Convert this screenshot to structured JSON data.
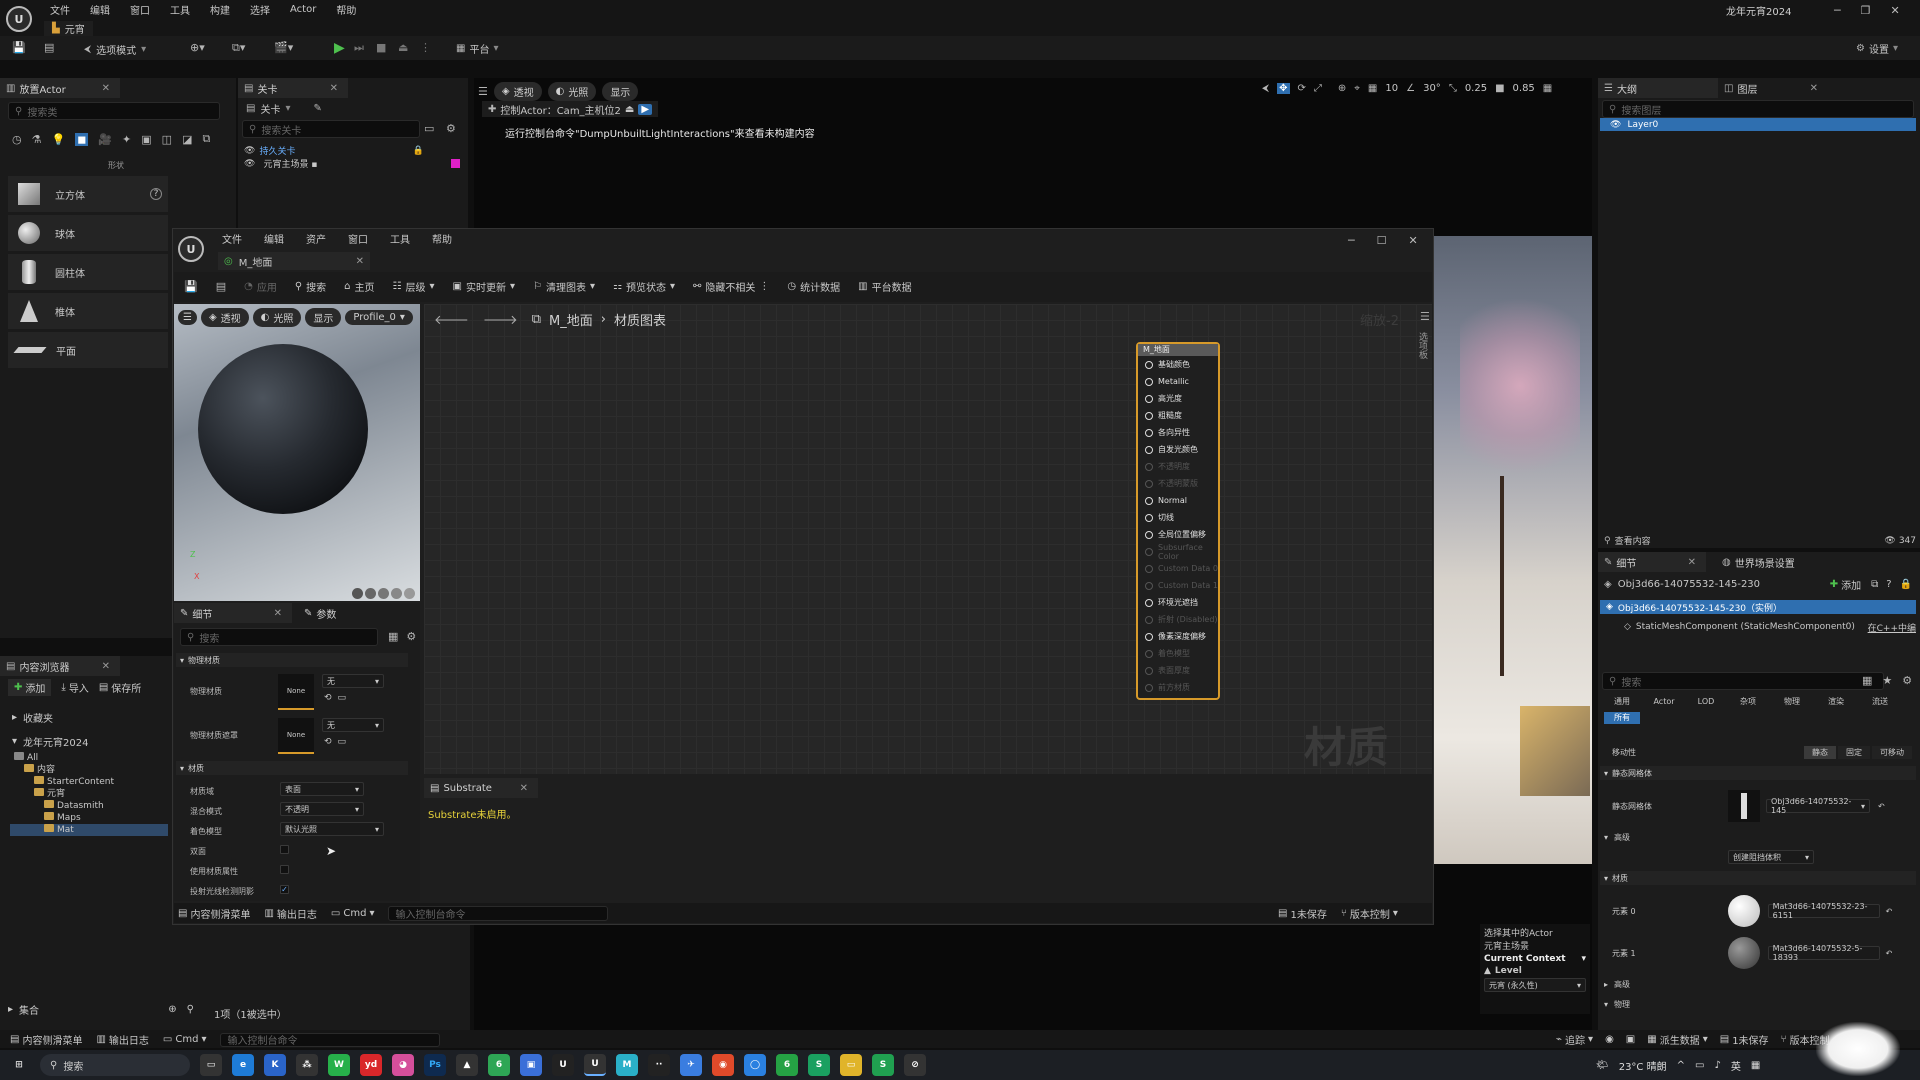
{
  "main_menu": {
    "items": [
      "文件",
      "编辑",
      "窗口",
      "工具",
      "构建",
      "选择",
      "Actor",
      "帮助"
    ],
    "project_title": "龙年元宵2024"
  },
  "level_tab": {
    "label": "元宵"
  },
  "toolbar": {
    "mode_label": "选项模式",
    "platform_label": "平台",
    "settings_label": "设置"
  },
  "place_actors": {
    "tab": "放置Actor",
    "search_placeholder": "搜索类",
    "category": "形状",
    "items": [
      {
        "label": "立方体",
        "icon": "cube-icon"
      },
      {
        "label": "球体",
        "icon": "sphere-icon"
      },
      {
        "label": "圆柱体",
        "icon": "cylinder-icon"
      },
      {
        "label": "椎体",
        "icon": "cone-icon"
      },
      {
        "label": "平面",
        "icon": "plane-icon"
      }
    ]
  },
  "levels_panel": {
    "tab": "关卡",
    "dropdown": "关卡",
    "search_placeholder": "搜索关卡",
    "items": [
      "持久关卡",
      "元宵主场景 ▪"
    ]
  },
  "viewport": {
    "buttons": [
      "透视",
      "光照",
      "显示"
    ],
    "pilot_label": "控制Actor：Cam_主机位2",
    "warning": "运行控制台命令\"DumpUnbuiltLightInteractions\"来查看未构建内容",
    "grid_snap": "10",
    "rot_snap": "30°",
    "scale_snap": "0.25",
    "cam_speed": "0.85"
  },
  "outliner": {
    "tab1": "大纲",
    "tab2": "图层",
    "search_placeholder": "搜索图层",
    "layer": "Layer0",
    "view_content": "查看内容",
    "count": "347"
  },
  "details": {
    "tab1": "细节",
    "tab2": "世界场景设置",
    "object_name": "Obj3d66-14075532-145-230",
    "add_label": "添加",
    "instance_label": "Obj3d66-14075532-145-230（实例）",
    "component_label": "StaticMeshComponent (StaticMeshComponent0)",
    "cpp_link": "在C++中编",
    "search_placeholder": "搜索",
    "filters": [
      "通用",
      "Actor",
      "LOD",
      "杂项",
      "物理",
      "渲染",
      "流送"
    ],
    "all_filter": "所有",
    "mobility_label": "移动性",
    "mobility_opts": [
      "静态",
      "固定",
      "可移动"
    ],
    "static_mesh_section": "静态网格体",
    "static_mesh_label": "静态网格体",
    "static_mesh_value": "Obj3d66-14075532-145",
    "advanced": "高级",
    "create_btn": "创建阻挡体积",
    "materials_section": "材质",
    "elements": [
      {
        "label": "元素 0",
        "value": "Mat3d66-14075532-23-6151"
      },
      {
        "label": "元素 1",
        "value": "Mat3d66-14075532-5-18393"
      }
    ],
    "advanced2": "高级",
    "physics": "物理"
  },
  "context_box": {
    "line1": "选择其中的Actor",
    "line2": "元宵主场景",
    "current_context": "Current Context",
    "level": "Level",
    "level_value": "元宵 (永久性)"
  },
  "content_browser": {
    "tab": "内容浏览器",
    "add": "添加",
    "import": "导入",
    "save_all": "保存所",
    "favorites": "收藏夹",
    "project": "龙年元宵2024",
    "tree": [
      "All",
      "内容",
      "StarterContent",
      "元宵",
      "Datasmith",
      "Maps",
      "Mat"
    ],
    "collections": "集合",
    "status": "1项（1被选中）"
  },
  "material_editor": {
    "menu": [
      "文件",
      "编辑",
      "资产",
      "窗口",
      "工具",
      "帮助"
    ],
    "tab": "M_地面",
    "toolbar": [
      "应用",
      "搜索",
      "主页",
      "层级",
      "实时更新",
      "清理图表",
      "预览状态",
      "隐藏不相关",
      "统计数据",
      "平台数据"
    ],
    "preview_buttons": [
      "透视",
      "光照",
      "显示",
      "Profile_0"
    ],
    "breadcrumb": [
      "M_地面",
      "材质图表"
    ],
    "zoom": "缩放-2",
    "watermark": "材质",
    "palette": "选项板",
    "node_title": "M_地面",
    "pins": [
      {
        "label": "基础颜色",
        "on": true
      },
      {
        "label": "Metallic",
        "on": true
      },
      {
        "label": "高光度",
        "on": true
      },
      {
        "label": "粗糙度",
        "on": true
      },
      {
        "label": "各向异性",
        "on": true
      },
      {
        "label": "自发光颜色",
        "on": true
      },
      {
        "label": "不透明度",
        "on": false
      },
      {
        "label": "不透明蒙版",
        "on": false
      },
      {
        "label": "Normal",
        "on": true
      },
      {
        "label": "切线",
        "on": true
      },
      {
        "label": "全局位置偏移",
        "on": true
      },
      {
        "label": "Subsurface Color",
        "on": false
      },
      {
        "label": "Custom Data 0",
        "on": false
      },
      {
        "label": "Custom Data 1",
        "on": false
      },
      {
        "label": "环境光遮挡",
        "on": true
      },
      {
        "label": "折射 (Disabled)",
        "on": false
      },
      {
        "label": "像素深度偏移",
        "on": true
      },
      {
        "label": "着色模型",
        "on": false
      },
      {
        "label": "表面厚度",
        "on": false
      },
      {
        "label": "前方材质",
        "on": false
      }
    ],
    "details_tab": "细节",
    "params_tab": "参数",
    "search_placeholder": "搜索",
    "phys_section": "物理材质",
    "phys_mat_label": "物理材质",
    "phys_mask_label": "物理材质遮罩",
    "none": "None",
    "none_dd": "无",
    "mat_section": "材质",
    "domain_label": "材质域",
    "domain_value": "表面",
    "blend_label": "混合模式",
    "blend_value": "不透明",
    "shading_label": "着色模型",
    "shading_value": "默认光照",
    "two_sided": "双面",
    "use_mat_attr": "使用材质属性",
    "cast_ray": "投射光线检测阴影",
    "substrate_tab": "Substrate",
    "substrate_msg": "Substrate未启用。",
    "bottom": [
      "内容侧滑菜单",
      "输出日志",
      "Cmd"
    ],
    "cmd_placeholder": "输入控制台命令",
    "unsaved": "1未保存",
    "source_control": "版本控制"
  },
  "status_bar": {
    "items": [
      "内容侧滑菜单",
      "输出日志",
      "Cmd"
    ],
    "cmd_placeholder": "输入控制台命令",
    "trace": "追踪",
    "derived": "派生数据",
    "unsaved": "1未保存",
    "source": "版本控制"
  },
  "taskbar": {
    "search": "搜索",
    "weather": "23°C 晴朗",
    "lang": "英"
  }
}
